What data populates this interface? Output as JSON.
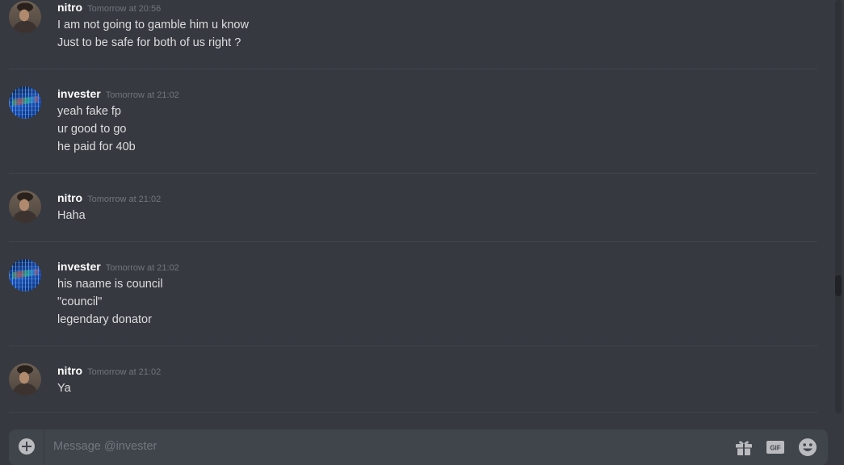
{
  "messages": [
    {
      "author": "nitro",
      "timestamp": "Tomorrow at 20:56",
      "lines": [
        "I am not going to gamble him u know",
        "Just to be safe for both of us right ?"
      ]
    },
    {
      "author": "invester",
      "timestamp": "Tomorrow at 21:02",
      "lines": [
        "yeah fake fp",
        "ur good to go",
        "he paid for 40b"
      ]
    },
    {
      "author": "nitro",
      "timestamp": "Tomorrow at 21:02",
      "lines": [
        "Haha"
      ]
    },
    {
      "author": "invester",
      "timestamp": "Tomorrow at 21:02",
      "lines": [
        "his naame is council",
        "\"council\"",
        "legendary donator"
      ]
    },
    {
      "author": "nitro",
      "timestamp": "Tomorrow at 21:02",
      "lines": [
        "Ya"
      ]
    }
  ],
  "composer": {
    "placeholder": "Message @invester",
    "value": "",
    "add_icon": "plus-circle",
    "gift_icon": "gift",
    "gif_icon": "gif",
    "gif_label": "GIF",
    "emoji_icon": "smile"
  },
  "colors": {
    "background": "#36393f",
    "username": "#ffffff",
    "text": "#dcddde",
    "muted": "#72767d",
    "input_bg": "#40444b"
  }
}
